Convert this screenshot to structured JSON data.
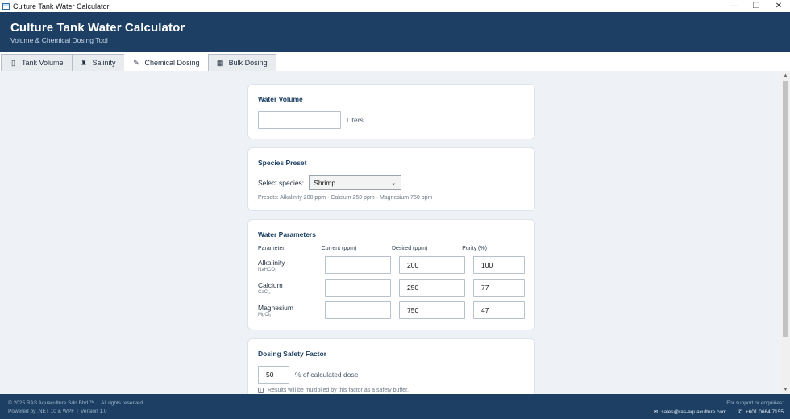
{
  "window": {
    "title": "Culture Tank Water Calculator",
    "controls": {
      "minimize": "—",
      "maximize": "❐",
      "close": "✕"
    }
  },
  "header": {
    "title": "Culture Tank Water Calculator",
    "subtitle": "Volume & Chemical Dosing Tool"
  },
  "tabs": [
    {
      "label": "Tank Volume",
      "icon": "▯",
      "icon_name": "tank-icon"
    },
    {
      "label": "Salinity",
      "icon": "♜",
      "icon_name": "bottle-icon"
    },
    {
      "label": "Chemical Dosing",
      "icon": "✎",
      "icon_name": "dropper-icon",
      "active": true
    },
    {
      "label": "Bulk Dosing",
      "icon": "▦",
      "icon_name": "bar-chart-icon"
    }
  ],
  "water_volume": {
    "heading": "Water Volume",
    "value": "",
    "unit": "Liters"
  },
  "species": {
    "heading": "Species Preset",
    "label": "Select species:",
    "selected": "Shrimp",
    "presets": "Presets: Alkalinity 200 ppm · Calcium 250 ppm · Magnesium 750 ppm"
  },
  "parameters": {
    "heading": "Water Parameters",
    "columns": [
      "Parameter",
      "Current (ppm)",
      "Desired (ppm)",
      "Purity (%)"
    ],
    "rows": [
      {
        "name": "Alkalinity",
        "formula": "NaHCO₃",
        "current": "",
        "desired": "200",
        "purity": "100"
      },
      {
        "name": "Calcium",
        "formula": "CaCl₂",
        "current": "",
        "desired": "250",
        "purity": "77"
      },
      {
        "name": "Magnesium",
        "formula": "MgCl₂",
        "current": "",
        "desired": "750",
        "purity": "47"
      }
    ]
  },
  "safety": {
    "heading": "Dosing Safety Factor",
    "value": "50",
    "suffix": "% of calculated dose",
    "info_icon": "i",
    "note": "Results will be multiplied by this factor as a safety buffer."
  },
  "footer": {
    "copyright": "© 2025 RAS Aquaculture Sdn Bhd ™",
    "rights": "All rights reserved.",
    "powered": "Powered by .NET 10 & WPF",
    "version": "Version 1.0",
    "support": "For support or enquiries:",
    "email": "sales@ras-aquaculture.com",
    "phone": "+601 0664 7155"
  },
  "colors": {
    "header": "#1c3f63",
    "background": "#eef1f5",
    "card": "#ffffff"
  }
}
